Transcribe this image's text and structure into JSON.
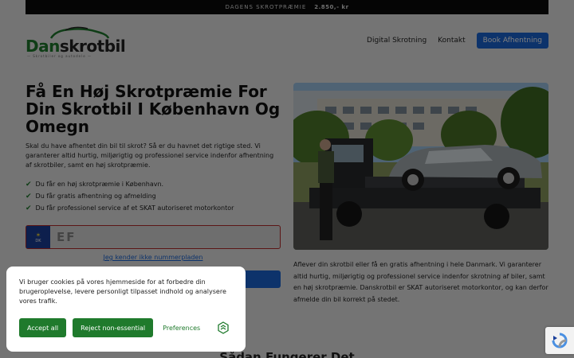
{
  "topbar": {
    "label": "DAGENS SKROTPRÆMIE",
    "value": "2.850,- kr"
  },
  "logo": {
    "name_part1": "Dan",
    "name_part2": "skrotbil",
    "tagline": "— Skrotbiler og autodele —"
  },
  "nav": {
    "items": [
      {
        "label": "Digital Skrotning"
      },
      {
        "label": "Kontakt"
      }
    ],
    "book_label": "Book Afhentning"
  },
  "hero": {
    "title": "Få En Høj Skrotpræmie For Din Skrotbil I København Og Omegn",
    "intro": "Skal du have afhentet din bil til skrot? Så er du havnet det rigtige sted. Vi garanterer altid hurtig, miljørigtig og professionel service indenfor afhentning af skrotbiler, samt en høj skrotpræmie.",
    "checks": [
      "Du får en høj skrotpræmie i København.",
      "Du får gratis afhentning og afmelding",
      "Du får professionel service af et SKAT autoriseret motorkontor"
    ],
    "plate": {
      "country": "DK",
      "placeholder": "EF"
    },
    "no_plate_link": "Jeg kender ikke nummerpladen"
  },
  "right": {
    "paragraph": "Afl­ever din skrotbil eller få en gratis afhentning i hele Danmark. Vi garanterer altid hurtig, miljørigtig og professionel service indenfor skrotning af biler, samt en høj skrotpræmie. Danskrotbil er SKAT autoriseret motorkontor, og kan derfor afmelde din bil korrekt på stedet."
  },
  "section2": {
    "title": "Sådan Fungerer Det"
  },
  "cookie": {
    "message": "Vi bruger cookies på vores hjemmeside for at forbedre din brugeroplevelse, levere personligt tilpasset indhold og analysere vores trafik.",
    "accept_label": "Accept all",
    "reject_label": "Reject non-essential",
    "prefs_label": "Preferences"
  },
  "colors": {
    "brand_green": "#1f7a2c",
    "brand_blue": "#1b66d6",
    "topbar": "#0b0b0b"
  }
}
